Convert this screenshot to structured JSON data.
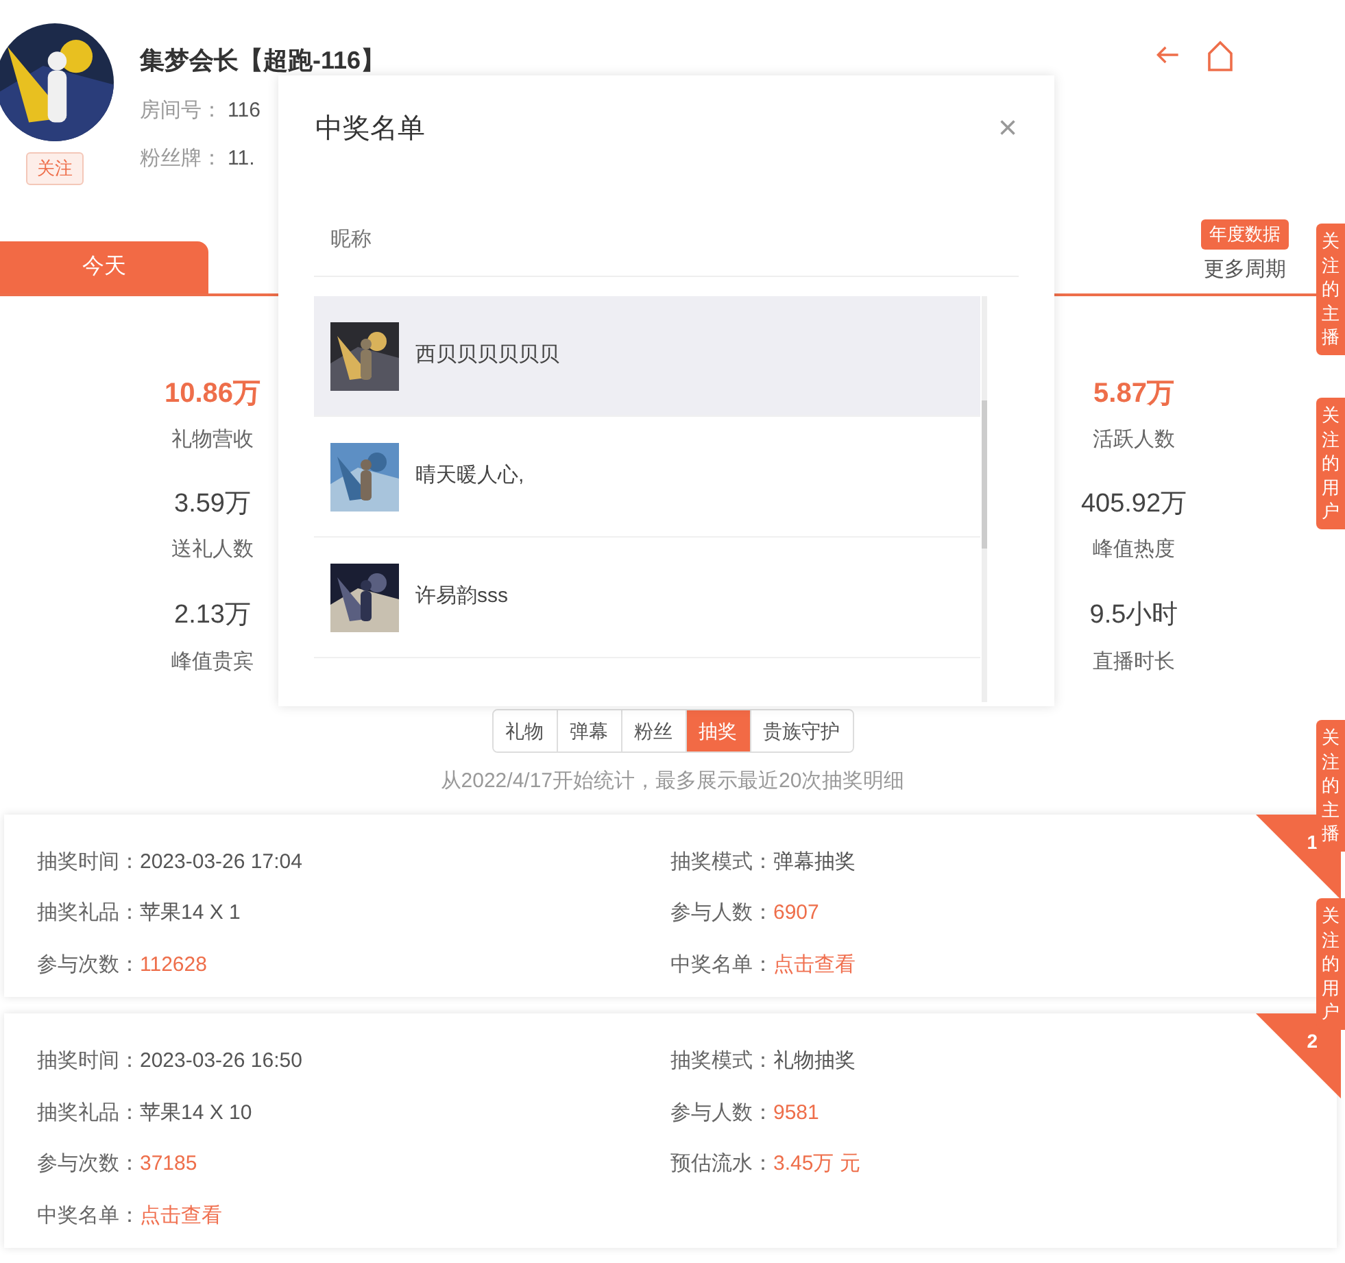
{
  "header": {
    "follow_button": "关注",
    "name": "集梦会长【超跑-116】",
    "room_label": "房间号：",
    "room_value": "116",
    "fan_badge_label": "粉丝牌：",
    "fan_badge_value": "11."
  },
  "period_tabs": [
    {
      "label": "今天",
      "selected": true
    }
  ],
  "period_badge": "年度数据",
  "more_periods": "更多周期",
  "stats_left": [
    {
      "value": "10.86万",
      "label": "礼物营收",
      "highlight": true
    },
    {
      "value": "3.59万",
      "label": "送礼人数",
      "highlight": false
    },
    {
      "value": "2.13万",
      "label": "峰值贵宾",
      "highlight": false
    }
  ],
  "stats_right": [
    {
      "value": "5.87万",
      "label": "活跃人数",
      "highlight": true
    },
    {
      "value": "405.92万",
      "label": "峰值热度",
      "highlight": false
    },
    {
      "value": "9.5小时",
      "label": "直播时长",
      "highlight": false
    }
  ],
  "side_tabs": [
    "关注的主播",
    "关注的用户",
    "关注的主播",
    "关注的用户"
  ],
  "segments": [
    {
      "label": "礼物",
      "selected": false
    },
    {
      "label": "弹幕",
      "selected": false
    },
    {
      "label": "粉丝",
      "selected": false
    },
    {
      "label": "抽奖",
      "selected": true
    },
    {
      "label": "贵族守护",
      "selected": false
    }
  ],
  "note": "从2022/4/17开始统计，最多展示最近20次抽奖明细",
  "lotteries": [
    {
      "rank": "1",
      "fields": [
        {
          "label": "抽奖时间：",
          "value": "2023-03-26 17:04",
          "kind": "text"
        },
        {
          "label": "抽奖模式：",
          "value": "弹幕抽奖",
          "kind": "text"
        },
        {
          "label": "抽奖礼品：",
          "value": "苹果14 X 1",
          "kind": "text"
        },
        {
          "label": "参与人数：",
          "value": "6907",
          "kind": "highlight"
        },
        {
          "label": "参与次数：",
          "value": "112628",
          "kind": "highlight"
        },
        {
          "label": "中奖名单：",
          "value": "点击查看",
          "kind": "link"
        }
      ]
    },
    {
      "rank": "2",
      "fields": [
        {
          "label": "抽奖时间：",
          "value": "2023-03-26 16:50",
          "kind": "text"
        },
        {
          "label": "抽奖模式：",
          "value": "礼物抽奖",
          "kind": "text"
        },
        {
          "label": "抽奖礼品：",
          "value": "苹果14 X 10",
          "kind": "text"
        },
        {
          "label": "参与人数：",
          "value": "9581",
          "kind": "highlight"
        },
        {
          "label": "参与次数：",
          "value": "37185",
          "kind": "highlight"
        },
        {
          "label": "预估流水：",
          "value": "3.45万 元",
          "kind": "highlight"
        },
        {
          "label": "中奖名单：",
          "value": "点击查看",
          "kind": "link"
        }
      ]
    }
  ],
  "dialog": {
    "title": "中奖名单",
    "close": "×",
    "column": "昵称",
    "winners": [
      {
        "nickname": "西贝贝贝贝贝贝",
        "selected": true
      },
      {
        "nickname": "晴天暖人心,",
        "selected": false
      },
      {
        "nickname": "许易韵sss",
        "selected": false
      }
    ]
  }
}
